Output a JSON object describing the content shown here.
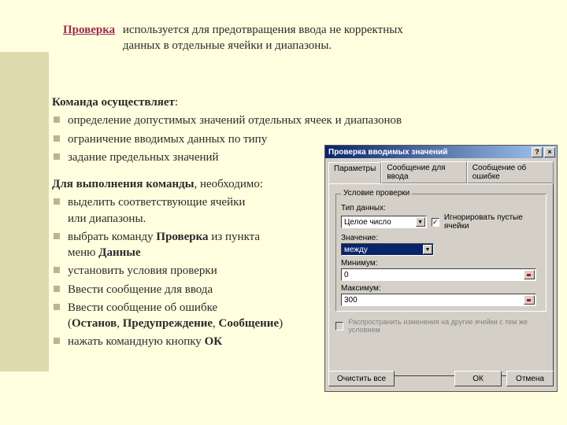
{
  "header": {
    "title": "Проверка",
    "desc1": "используется для предотвращения ввода не корректных",
    "desc2": "данных в отдельные ячейки и диапазоны."
  },
  "section1": {
    "heading": "Команда осуществляет",
    "colon": ":",
    "items": [
      " определение допустимых значений отдельных ячеек и  диапазонов",
      "ограничение вводимых данных по типу",
      "задание предельных значений"
    ]
  },
  "section2": {
    "heading": "Для выполнения команды",
    "tail": ", необходимо:",
    "items": [
      "выделить соответствующие ячейки или диапазоны.",
      "выбрать команду Проверка из пункта меню Данные",
      "установить условия проверки",
      "Ввести сообщение для ввода",
      "Ввести сообщение об ошибке (Останов, Предупреждение, Сообщение)",
      "нажать командную кнопку ОК"
    ]
  },
  "dialog": {
    "title": "Проверка вводимых значений",
    "help": "?",
    "close": "×",
    "tabs": [
      "Параметры",
      "Сообщение для ввода",
      "Сообщение об ошибке"
    ],
    "group_title": "Условие проверки",
    "lbl_type": "Тип данных:",
    "val_type": "Целое число",
    "chk_ignore": "Игнорировать пустые ячейки",
    "lbl_value": "Значение:",
    "val_value": "между",
    "lbl_min": "Минимум:",
    "val_min": "0",
    "lbl_max": "Максимум:",
    "val_max": "300",
    "chk_spread": "Распространить изменения на другие ячейки с тем же условием",
    "btn_clear": "Очистить все",
    "btn_ok": "ОК",
    "btn_cancel": "Отмена"
  }
}
